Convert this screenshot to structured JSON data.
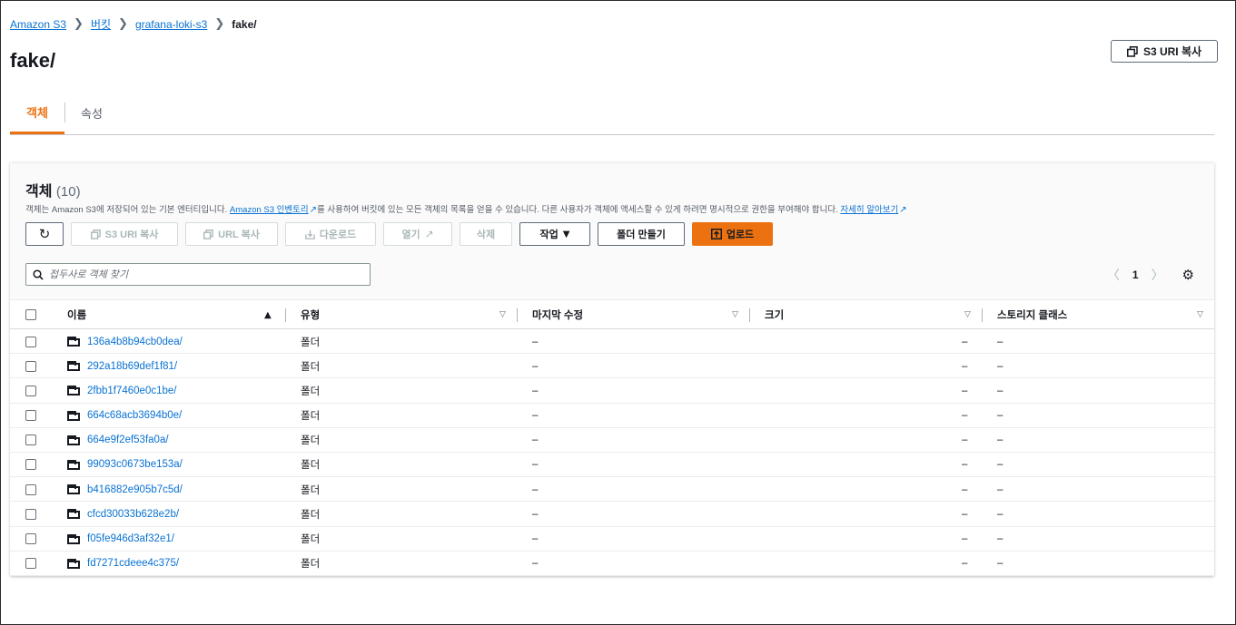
{
  "breadcrumb": {
    "items": [
      "Amazon S3",
      "버킷",
      "grafana-loki-s3"
    ],
    "current": "fake/",
    "separator": "❯"
  },
  "page": {
    "title": "fake/",
    "copy_uri_button": "S3 URI 복사"
  },
  "tabs": [
    {
      "label": "객체",
      "active": true
    },
    {
      "label": "속성",
      "active": false
    }
  ],
  "objects_panel": {
    "title": "객체",
    "count": "(10)",
    "description_part1": "객체는 Amazon S3에 저장되어 있는 기본 엔터티입니다.",
    "description_link1": "Amazon S3 인벤토리",
    "description_part2": "를 사용하여 버킷에 있는 모든 객체의 목록을 얻을 수 있습니다. 다른 사용자가 객체에 액세스할 수 있게 하려면 명시적으로 권한을 부여해야 합니다.",
    "description_link2": "자세히 알아보기"
  },
  "toolbar": {
    "refresh_icon": "refresh-icon",
    "copy_s3_uri": "S3 URI 복사",
    "copy_url": "URL 복사",
    "download": "다운로드",
    "open": "열기",
    "delete": "삭제",
    "actions": "작업",
    "create_folder": "폴더 만들기",
    "upload": "업로드"
  },
  "search": {
    "placeholder": "접두사로 객체 찾기"
  },
  "pagination": {
    "current_page": "1"
  },
  "table": {
    "columns": [
      "이름",
      "유형",
      "마지막 수정",
      "크기",
      "스토리지 클래스"
    ],
    "rows": [
      {
        "name": "136a4b8b94cb0dea/",
        "type": "폴더",
        "modified": "–",
        "size": "–",
        "storage": "–"
      },
      {
        "name": "292a18b69def1f81/",
        "type": "폴더",
        "modified": "–",
        "size": "–",
        "storage": "–"
      },
      {
        "name": "2fbb1f7460e0c1be/",
        "type": "폴더",
        "modified": "–",
        "size": "–",
        "storage": "–"
      },
      {
        "name": "664c68acb3694b0e/",
        "type": "폴더",
        "modified": "–",
        "size": "–",
        "storage": "–"
      },
      {
        "name": "664e9f2ef53fa0a/",
        "type": "폴더",
        "modified": "–",
        "size": "–",
        "storage": "–"
      },
      {
        "name": "99093c0673be153a/",
        "type": "폴더",
        "modified": "–",
        "size": "–",
        "storage": "–"
      },
      {
        "name": "b416882e905b7c5d/",
        "type": "폴더",
        "modified": "–",
        "size": "–",
        "storage": "–"
      },
      {
        "name": "cfcd30033b628e2b/",
        "type": "폴더",
        "modified": "–",
        "size": "–",
        "storage": "–"
      },
      {
        "name": "f05fe946d3af32e1/",
        "type": "폴더",
        "modified": "–",
        "size": "–",
        "storage": "–"
      },
      {
        "name": "fd7271cdeee4c375/",
        "type": "폴더",
        "modified": "–",
        "size": "–",
        "storage": "–"
      }
    ]
  },
  "colors": {
    "accent": "#ec7211",
    "link": "#0972d3",
    "text": "#16191f"
  }
}
